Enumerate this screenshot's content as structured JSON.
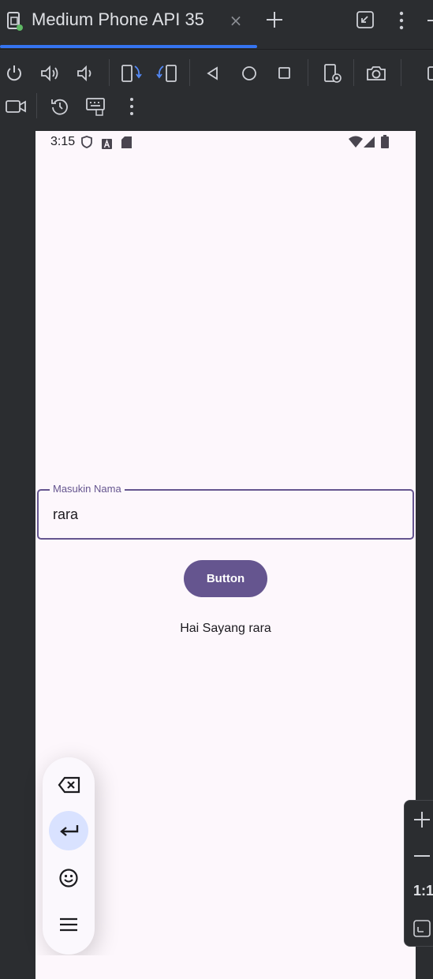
{
  "window": {
    "tab_title": "Medium Phone API 35",
    "close_symbol": "×"
  },
  "toolbar": {
    "icons": [
      "power-icon",
      "volume-up-icon",
      "volume-down-icon",
      "rotate-left-icon",
      "rotate-right-icon",
      "back-icon",
      "home-icon",
      "overview-icon",
      "device-settings-icon",
      "camera-icon",
      "more-icon",
      "record-icon",
      "reset-icon",
      "keyboard-icon",
      "overflow-icon"
    ]
  },
  "device": {
    "status_time": "3:15",
    "textfield": {
      "label": "Masukin Nama",
      "value": "rara"
    },
    "button_label": "Button",
    "greeting": "Hai Sayang rara"
  },
  "keyboard_panel": {
    "items": [
      "backspace-icon",
      "enter-icon",
      "emoji-icon",
      "menu-icon"
    ]
  },
  "zoom": {
    "ratio_label": "1:1"
  },
  "colors": {
    "accent": "#65558f",
    "tab_underline": "#3574f0",
    "device_bg": "#fdf7fc",
    "ide_bg": "#2b2d30"
  }
}
